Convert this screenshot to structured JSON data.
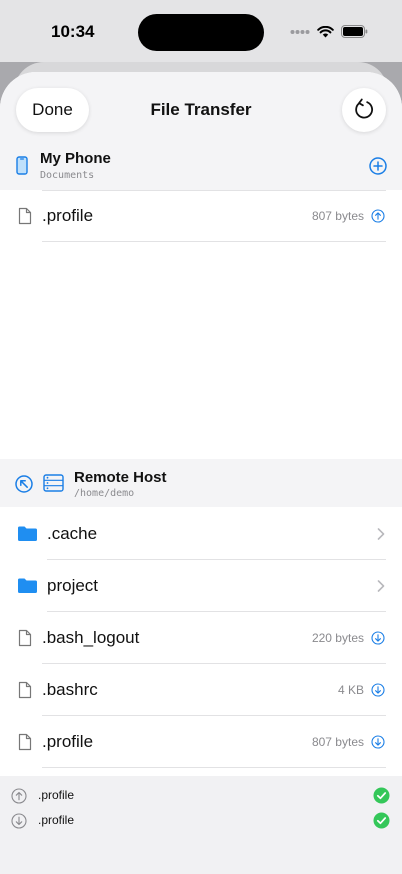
{
  "status": {
    "time": "10:34"
  },
  "nav": {
    "done_label": "Done",
    "title": "File Transfer"
  },
  "local": {
    "title": "My Phone",
    "path": "Documents",
    "files": [
      {
        "name": ".profile",
        "size": "807 bytes"
      }
    ]
  },
  "remote": {
    "title": "Remote Host",
    "path": "/home/demo",
    "folders": [
      {
        "name": ".cache"
      },
      {
        "name": "project"
      }
    ],
    "files": [
      {
        "name": ".bash_logout",
        "size": "220 bytes"
      },
      {
        "name": ".bashrc",
        "size": "4 KB"
      },
      {
        "name": ".profile",
        "size": "807 bytes"
      }
    ]
  },
  "transfers": [
    {
      "direction": "upload",
      "name": ".profile",
      "status": "complete"
    },
    {
      "direction": "download",
      "name": ".profile",
      "status": "complete"
    }
  ],
  "colors": {
    "accent": "#1a7ee6",
    "success": "#34c759",
    "folder": "#1f8ef1"
  }
}
